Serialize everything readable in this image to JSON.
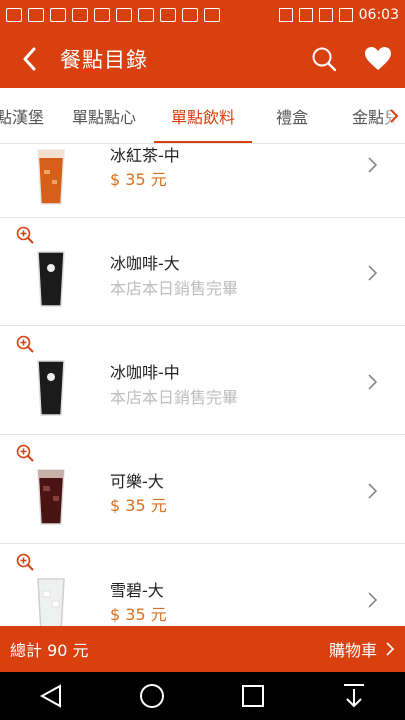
{
  "status_bar": {
    "time": "06:03"
  },
  "app_bar": {
    "title": "餐點目錄"
  },
  "tabs": [
    {
      "label": "點漢堡",
      "active": false
    },
    {
      "label": "單點點心",
      "active": false
    },
    {
      "label": "單點飲料",
      "active": true
    },
    {
      "label": "禮盒",
      "active": false
    },
    {
      "label": "金點兒",
      "active": false
    }
  ],
  "items": [
    {
      "name": "冰紅茶-中",
      "sub": "$ 35 元",
      "sold_out": false,
      "drink": "tea"
    },
    {
      "name": "冰咖啡-大",
      "sub": "本店本日銷售完畢",
      "sold_out": true,
      "drink": "coffee"
    },
    {
      "name": "冰咖啡-中",
      "sub": "本店本日銷售完畢",
      "sold_out": true,
      "drink": "coffee"
    },
    {
      "name": "可樂-大",
      "sub": "$ 35 元",
      "sold_out": false,
      "drink": "cola"
    },
    {
      "name": "雪碧-大",
      "sub": "$ 35 元",
      "sold_out": false,
      "drink": "sprite"
    }
  ],
  "cart": {
    "total_label": "總計 90 元",
    "cart_label": "購物車"
  },
  "colors": {
    "accent": "#d8400f",
    "price": "#d8701f",
    "sold_out": "#bdbdbd"
  }
}
